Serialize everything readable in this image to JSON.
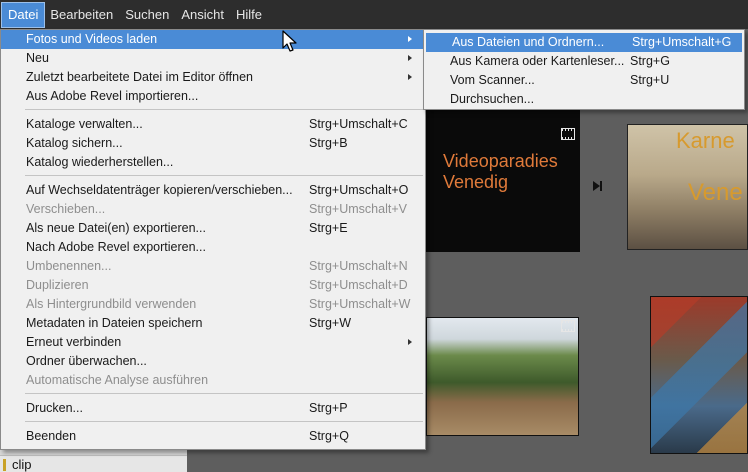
{
  "menubar": {
    "items": [
      {
        "label": "Datei"
      },
      {
        "label": "Bearbeiten"
      },
      {
        "label": "Suchen"
      },
      {
        "label": "Ansicht"
      },
      {
        "label": "Hilfe"
      }
    ]
  },
  "file_menu": {
    "items": [
      {
        "label": "Fotos und Videos laden",
        "shortcut": ""
      },
      {
        "label": "Neu",
        "shortcut": ""
      },
      {
        "label": "Zuletzt bearbeitete Datei im Editor öffnen",
        "shortcut": ""
      },
      {
        "label": "Aus Adobe Revel importieren...",
        "shortcut": ""
      },
      {
        "label": "Kataloge verwalten...",
        "shortcut": "Strg+Umschalt+C"
      },
      {
        "label": "Katalog sichern...",
        "shortcut": "Strg+B"
      },
      {
        "label": "Katalog wiederherstellen...",
        "shortcut": ""
      },
      {
        "label": "Auf Wechseldatenträger kopieren/verschieben...",
        "shortcut": "Strg+Umschalt+O"
      },
      {
        "label": "Verschieben...",
        "shortcut": "Strg+Umschalt+V"
      },
      {
        "label": "Als neue Datei(en) exportieren...",
        "shortcut": "Strg+E"
      },
      {
        "label": "Nach Adobe Revel exportieren...",
        "shortcut": ""
      },
      {
        "label": "Umbenennen...",
        "shortcut": "Strg+Umschalt+N"
      },
      {
        "label": "Duplizieren",
        "shortcut": "Strg+Umschalt+D"
      },
      {
        "label": "Als Hintergrundbild verwenden",
        "shortcut": "Strg+Umschalt+W"
      },
      {
        "label": "Metadaten in Dateien speichern",
        "shortcut": "Strg+W"
      },
      {
        "label": "Erneut verbinden",
        "shortcut": ""
      },
      {
        "label": "Ordner überwachen...",
        "shortcut": ""
      },
      {
        "label": "Automatische Analyse ausführen",
        "shortcut": ""
      },
      {
        "label": "Drucken...",
        "shortcut": "Strg+P"
      },
      {
        "label": "Beenden",
        "shortcut": "Strg+Q"
      }
    ]
  },
  "sub_menu": {
    "items": [
      {
        "label": "Aus Dateien und Ordnern...",
        "shortcut": "Strg+Umschalt+G"
      },
      {
        "label": "Aus Kamera oder Kartenleser...",
        "shortcut": "Strg+G"
      },
      {
        "label": "Vom Scanner...",
        "shortcut": "Strg+U"
      },
      {
        "label": "Durchsuchen...",
        "shortcut": ""
      }
    ]
  },
  "thumbnails": {
    "video_title_line1": "Videoparadies",
    "video_title_line2": "Venedig",
    "partial_title_1": "Karne",
    "partial_title_2": "Vene"
  },
  "left_panel": {
    "clip_label": "clip"
  },
  "colors": {
    "menubar_bg": "#2d2d2d",
    "highlight": "#4a8bd6",
    "menu_bg": "#f0f0f0",
    "disabled_text": "#8e8e8e",
    "video_title": "#e07a3a"
  }
}
